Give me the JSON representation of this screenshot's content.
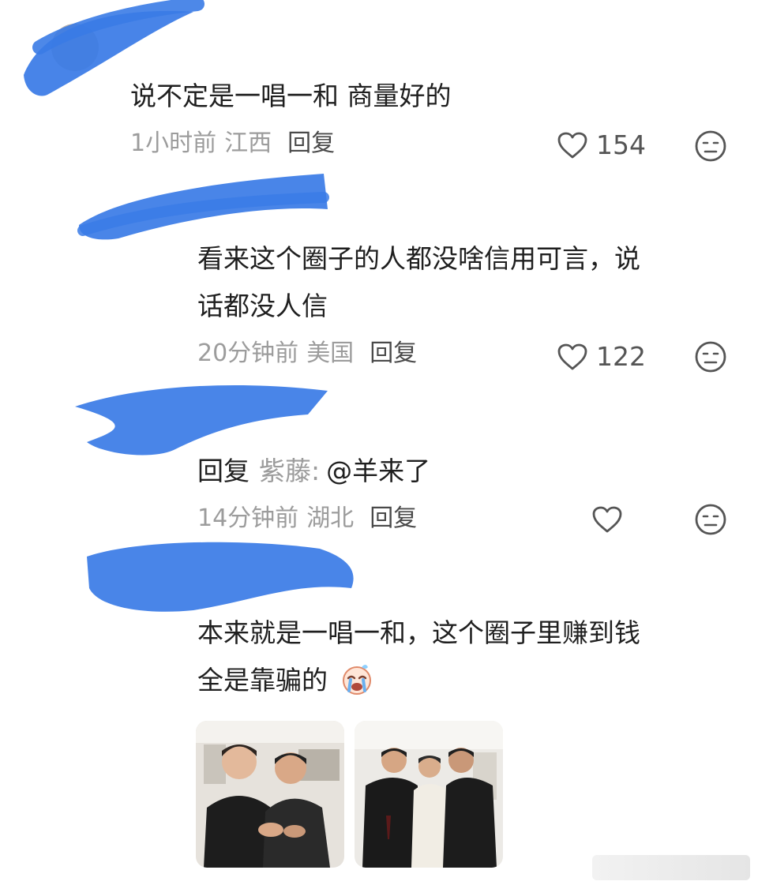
{
  "comments": [
    {
      "text": "说不定是一唱一和  商量好的",
      "time": "1小时前",
      "location": "江西",
      "reply_label": "回复",
      "likes": "154"
    },
    {
      "text_line1": "看来这个圈子的人都没啥信用可言，说",
      "text_line2": "话都没人信",
      "time": "20分钟前",
      "location": "美国",
      "reply_label": "回复",
      "likes": "122"
    },
    {
      "reply_prefix": "回复",
      "reply_to": "紫藤:",
      "text": "@羊来了",
      "time": "14分钟前",
      "location": "湖北",
      "reply_label": "回复",
      "likes": ""
    },
    {
      "text_line1": "本来就是一唱一和，这个圈子里赚到钱",
      "text_line2": "全是靠骗的",
      "emoji": "crying-face-emoji"
    }
  ],
  "icons": {
    "like": "heart-outline-icon",
    "dislike": "neutral-face-icon"
  },
  "colors": {
    "redaction": "#3a7be6",
    "meta_text": "#9c9c9c",
    "body_text": "#1f1f1f"
  }
}
